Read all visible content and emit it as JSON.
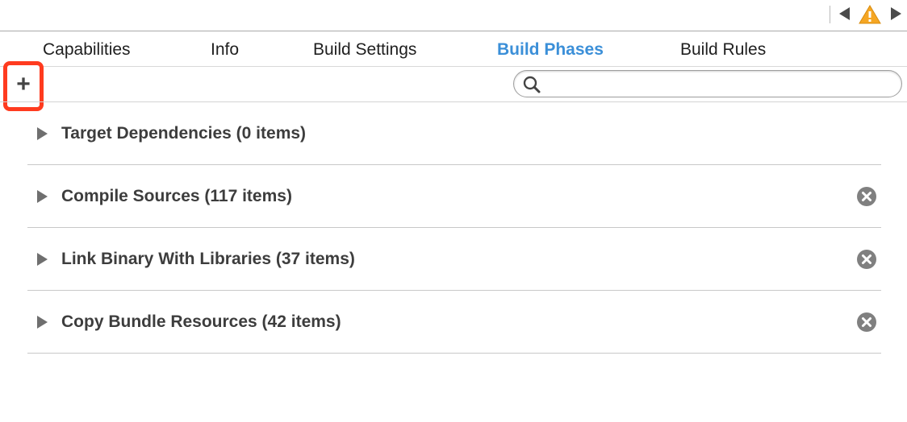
{
  "toolbar": {
    "back_icon": "triangle-left-icon",
    "warning_icon": "warning-icon",
    "warning_color": "#f5a623",
    "forward_icon": "triangle-right-icon"
  },
  "tabs": [
    {
      "label": "Capabilities",
      "active": false
    },
    {
      "label": "Info",
      "active": false
    },
    {
      "label": "Build Settings",
      "active": false
    },
    {
      "label": "Build Phases",
      "active": true
    },
    {
      "label": "Build Rules",
      "active": false
    }
  ],
  "accent_color": "#3b8fd8",
  "highlight_color": "#ff3b1f",
  "actions": {
    "add_label": "+",
    "add_icon": "plus-icon"
  },
  "search": {
    "value": "",
    "placeholder": "",
    "icon": "search-icon"
  },
  "phases": [
    {
      "title": "Target Dependencies (0 items)",
      "removable": false
    },
    {
      "title": "Compile Sources (117 items)",
      "removable": true
    },
    {
      "title": "Link Binary With Libraries (37 items)",
      "removable": true
    },
    {
      "title": "Copy Bundle Resources (42 items)",
      "removable": true
    }
  ]
}
